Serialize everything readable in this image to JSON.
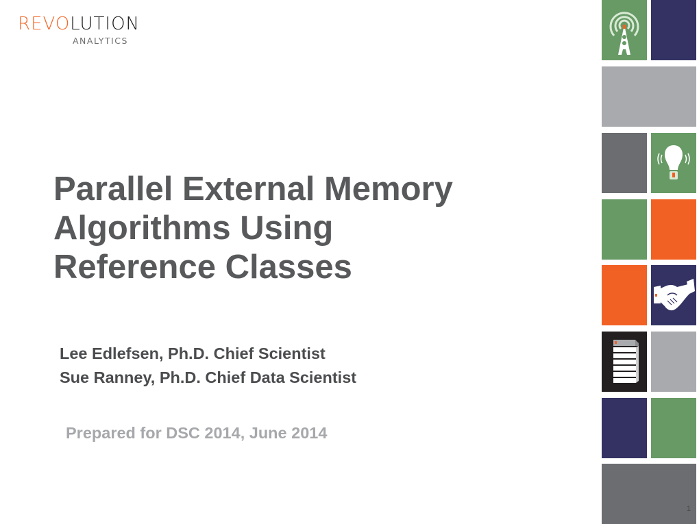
{
  "logo": {
    "brand_orange": "REVO",
    "brand_black": "LUTION",
    "subtitle": "ANALYTICS"
  },
  "title": {
    "lines": [
      "Parallel External Memory",
      "Algorithms Using",
      "Reference Classes"
    ]
  },
  "authors": [
    "Lee Edlefsen, Ph.D. Chief Scientist",
    "Sue Ranney, Ph.D. Chief Data Scientist"
  ],
  "prepared": "Prepared for DSC 2014, June 2014",
  "page_number": "1",
  "colors": {
    "green": "#679a65",
    "navy": "#333263",
    "light_gray": "#a9aaad",
    "dark_gray": "#6c6d70",
    "orange": "#f26124",
    "black": "#231f20",
    "title_text": "#58595b",
    "prepared_text": "#a7a8ab"
  },
  "tiles": [
    {
      "color": "green",
      "icon": "radio-tower-icon"
    },
    {
      "color": "navy",
      "icon": null
    },
    {
      "color": "light_gray",
      "icon": null
    },
    {
      "color": "dark_gray",
      "icon": null
    },
    {
      "color": "green",
      "icon": "lightbulb-icon"
    },
    {
      "color": "green",
      "icon": null
    },
    {
      "color": "orange",
      "icon": null
    },
    {
      "color": "orange",
      "icon": null
    },
    {
      "color": "navy",
      "icon": "handshake-icon"
    },
    {
      "color": "black",
      "icon": "database-stack-icon"
    },
    {
      "color": "light_gray",
      "icon": null
    },
    {
      "color": "navy",
      "icon": null
    },
    {
      "color": "green",
      "icon": null
    },
    {
      "color": "dark_gray",
      "icon": null
    }
  ]
}
